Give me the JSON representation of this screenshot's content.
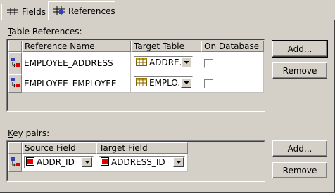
{
  "tabs": [
    {
      "label": "Fields",
      "icon": "fields-icon",
      "active": false
    },
    {
      "label": "References",
      "icon": "references-icon",
      "active": true
    }
  ],
  "table_references": {
    "label": "Table References:",
    "columns": [
      "Reference Name",
      "Target Table",
      "On Database"
    ],
    "rows": [
      {
        "reference_name": "EMPLOYEE_ADDRESS",
        "target_table": "ADDRE...",
        "on_database": false
      },
      {
        "reference_name": "EMPLOYEE_EMPLOYEE",
        "target_table": "EMPLO...",
        "on_database": false
      }
    ],
    "add_label": "Add...",
    "remove_label": "Remove"
  },
  "key_pairs": {
    "label": "Key pairs:",
    "columns": [
      "Source Field",
      "Target Field"
    ],
    "rows": [
      {
        "source_field": "ADDR_ID",
        "target_field": "ADDRESS_ID"
      }
    ],
    "add_label": "Add...",
    "remove_label": "Remove"
  },
  "colors": {
    "field_icon": "#e00000",
    "table_icon": "#c8a000"
  }
}
